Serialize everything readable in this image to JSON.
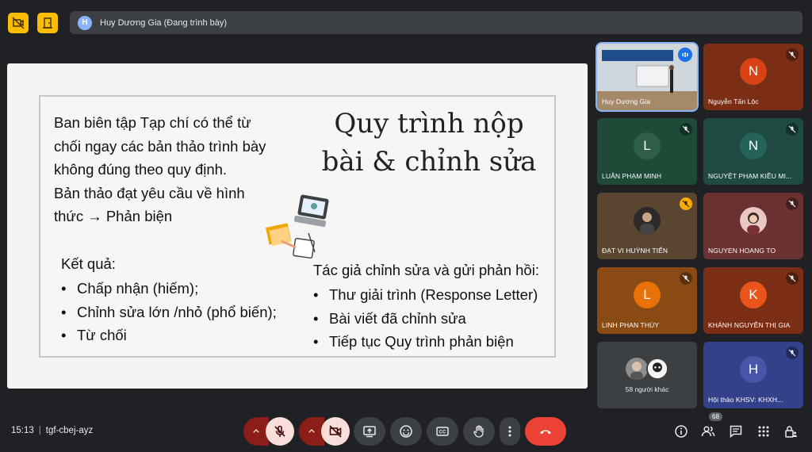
{
  "topbar": {
    "presenter_initial": "H",
    "presenter_label": "Huy Dương Gia (Đang trình bày)",
    "accent": "#fbbc04"
  },
  "slide": {
    "intro_lines": [
      "Ban biên tập Tạp chí có thể từ",
      "chối ngay các bản thảo trình bày",
      "không đúng theo quy định.",
      "Bản thảo đạt yêu cầu về hình",
      "thức → Phản biện"
    ],
    "title_lines": [
      "Quy trình nộp",
      "bài & chỉnh sửa"
    ],
    "results_heading": "Kết quả:",
    "results": [
      "Chấp nhận (hiếm);",
      "Chỉnh sửa lớn /nhỏ (phổ biến);",
      "Từ chối"
    ],
    "author_heading": "Tác giả chỉnh sửa và gửi phản hồi:",
    "author_items": [
      "Thư giải trình (Response Letter)",
      "Bài viết đã chỉnh sửa",
      "Tiếp tục Quy trình phản biện"
    ]
  },
  "tiles": [
    {
      "name": "Huy Dương Gia",
      "type": "video"
    },
    {
      "name": "Nguyễn Tấn Lộc",
      "initial": "N",
      "color": "#7a2e16",
      "avatar_color": "#d84315",
      "muted": true
    },
    {
      "name": "LUÂN PHẠM MINH",
      "initial": "L",
      "color": "#1e4a38",
      "avatar_color": "#2e5e48",
      "muted": true
    },
    {
      "name": "NGUYỆT PHẠM KIỀU MI...",
      "initial": "N",
      "color": "#1e4a42",
      "avatar_color": "#24635a",
      "muted": true
    },
    {
      "name": "ĐẠT VI HUỲNH TIẾN",
      "type": "photo",
      "color": "#5a4630",
      "muted": true
    },
    {
      "name": "NGUYEN HOANG TO",
      "type": "photo",
      "color": "#6b3030",
      "muted": true
    },
    {
      "name": "LINH PHAN THÙY",
      "initial": "L",
      "color": "#8a4a14",
      "avatar_color": "#e8710a",
      "muted": true
    },
    {
      "name": "KHÁNH NGUYỄN THỊ GIA",
      "initial": "K",
      "color": "#7a2e16",
      "avatar_color": "#e8541a",
      "muted": false
    },
    {
      "name": "58 người khác",
      "type": "others",
      "color": "#3c4043"
    },
    {
      "name": "Hội thảo KHSV: KHXH...",
      "initial": "H",
      "color": "#33418a",
      "avatar_color": "#4756a8",
      "muted": true
    }
  ],
  "bottombar": {
    "time": "15:13",
    "meeting_code": "tgf-cbej-ayz",
    "people_count": "68"
  }
}
